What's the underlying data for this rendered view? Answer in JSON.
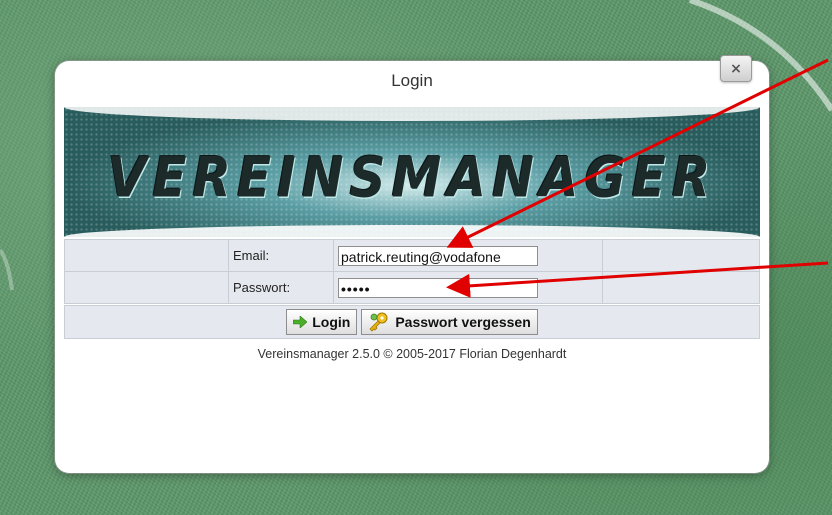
{
  "dialog": {
    "title": "Login",
    "close_label": "×",
    "banner_text": "VEREINSMANAGER"
  },
  "form": {
    "email_label": "Email:",
    "email_value": "patrick.reuting@vodafone",
    "password_label": "Passwort:",
    "password_value": "•••••"
  },
  "buttons": {
    "login_label": "Login",
    "forgot_label": "Passwort vergessen"
  },
  "footer": {
    "text": "Vereinsmanager 2.5.0 © 2005-2017 Florian Degenhardt"
  },
  "colors": {
    "annotation_arrow": "#e00000",
    "form_background": "#e5e8ef",
    "grass": "#5f9a6c"
  },
  "icons": {
    "login": "green-arrow-right-icon",
    "forgot": "keys-icon",
    "close": "close-icon"
  }
}
